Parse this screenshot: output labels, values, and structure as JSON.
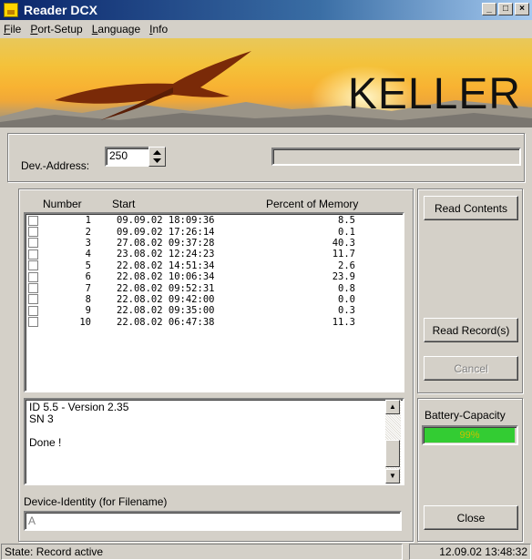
{
  "window": {
    "title": "Reader DCX",
    "icon_text": "KELLER"
  },
  "menu": [
    {
      "label": "ile",
      "accel": "F"
    },
    {
      "label": "ort-Setup",
      "accel": "P"
    },
    {
      "label": "anguage",
      "accel": "L"
    },
    {
      "label": "nfo",
      "accel": "I"
    }
  ],
  "banner": {
    "brand": "KELLER"
  },
  "device": {
    "address_label": "Dev.-Address:",
    "address_value": "250"
  },
  "records": {
    "headers": {
      "number": "Number",
      "start": "Start",
      "percent": "Percent of Memory"
    },
    "rows": [
      {
        "number": "1",
        "start": "09.09.02 18:09:36",
        "percent": "8.5"
      },
      {
        "number": "2",
        "start": "09.09.02 17:26:14",
        "percent": "0.1"
      },
      {
        "number": "3",
        "start": "27.08.02 09:37:28",
        "percent": "40.3"
      },
      {
        "number": "4",
        "start": "23.08.02 12:24:23",
        "percent": "11.7"
      },
      {
        "number": "5",
        "start": "22.08.02 14:51:34",
        "percent": "2.6"
      },
      {
        "number": "6",
        "start": "22.08.02 10:06:34",
        "percent": "23.9"
      },
      {
        "number": "7",
        "start": "22.08.02 09:52:31",
        "percent": "0.8"
      },
      {
        "number": "8",
        "start": "22.08.02 09:42:00",
        "percent": "0.0"
      },
      {
        "number": "9",
        "start": "22.08.02 09:35:00",
        "percent": "0.3"
      },
      {
        "number": "10",
        "start": "22.08.02 06:47:38",
        "percent": "11.3"
      }
    ]
  },
  "log": {
    "lines": [
      "ID 5.5 - Version  2.35",
      "SN 3",
      "",
      "Done !"
    ]
  },
  "identity": {
    "label": "Device-Identity (for Filename)",
    "value": "A"
  },
  "buttons": {
    "read_contents": "Read Contents",
    "read_records": "Read Record(s)",
    "cancel": "Cancel",
    "close": "Close"
  },
  "battery": {
    "label": "Battery-Capacity",
    "value_text": "99%",
    "level": 0.99,
    "color": "#33cc33"
  },
  "status": {
    "state": "State: Record active",
    "datetime": "12.09.02 13:48:32"
  }
}
